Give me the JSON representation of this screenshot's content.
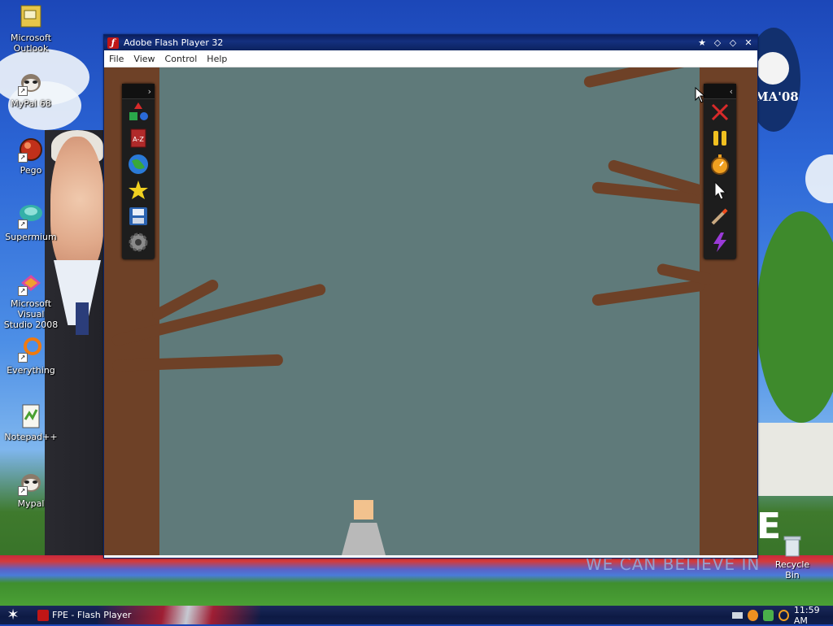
{
  "desktop": {
    "icons": [
      {
        "label": "Microsoft\nOutlook",
        "icon": "outlook-icon"
      },
      {
        "label": "MyPal 68",
        "icon": "mypal-icon"
      },
      {
        "label": "Pego",
        "icon": "pego-icon"
      },
      {
        "label": "Supermium",
        "icon": "supermium-icon"
      },
      {
        "label": "Microsoft Visual\nStudio 2008",
        "icon": "visual-studio-icon"
      },
      {
        "label": "Everything",
        "icon": "everything-icon"
      },
      {
        "label": "Notepad++",
        "icon": "notepadpp-icon"
      },
      {
        "label": "Mypal",
        "icon": "mypal-icon"
      }
    ],
    "recycle_bin": "Recycle Bin",
    "wallpaper_text": "WE CAN BELIEVE IN",
    "wallpaper_logo": "MA'08"
  },
  "window": {
    "title": "Adobe Flash Player 32",
    "app_icon_glyph": "ƒ",
    "menu": [
      "File",
      "View",
      "Control",
      "Help"
    ],
    "toolbar_left": {
      "expand_glyph": "›",
      "tools": [
        "shapes-icon",
        "a-z-icon",
        "globe-icon",
        "star-icon",
        "save-icon",
        "settings-icon"
      ],
      "az_label": "A-Z"
    },
    "toolbar_right": {
      "collapse_glyph": "‹",
      "tools": [
        "close-x-icon",
        "pause-icon",
        "stopwatch-icon",
        "cursor-icon",
        "wand-icon",
        "lightning-icon"
      ]
    }
  },
  "taskbar": {
    "task_label": "FPE - Flash Player",
    "clock": "11:59 AM"
  },
  "colors": {
    "stage": "#5f7a7a",
    "trunk": "#6e4127",
    "player_head": "#f2c28e",
    "player_body": "#b9b9b9"
  }
}
